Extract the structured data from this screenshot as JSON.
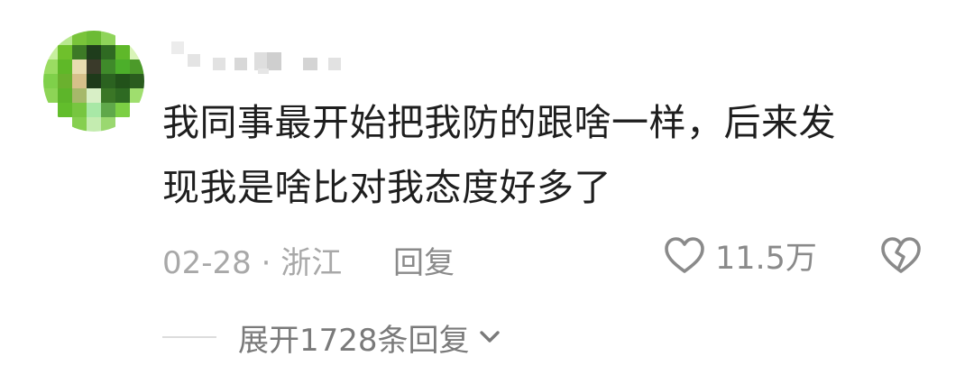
{
  "comment": {
    "content_line1": "我同事最开始把我防的跟啥一样，后来发",
    "content_line2": "现我是啥比对我态度好多了",
    "date": "02-28",
    "separator": "·",
    "location": "浙江",
    "reply_label": "回复",
    "like_count": "11.5万",
    "expand_label": "展开1728条回复"
  },
  "icons": {
    "like": "heart-outline-icon",
    "dislike": "broken-heart-icon",
    "expand": "chevron-down-icon"
  },
  "colors": {
    "text_primary": "#1e1e1e",
    "text_secondary": "#a8a8a8",
    "icon_gray": "#8a8a8a",
    "avatar_green": "#5fbf2a"
  }
}
